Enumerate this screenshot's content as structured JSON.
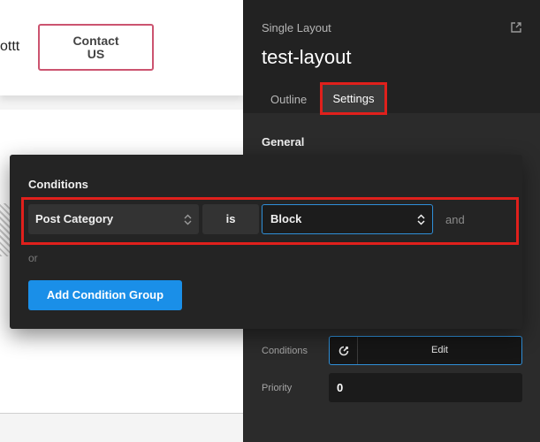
{
  "canvas": {
    "brand_fragment": "ottt",
    "contact_button_label": "Contact US"
  },
  "sidebar": {
    "subtitle": "Single Layout",
    "title": "test-layout",
    "tabs": [
      {
        "label": "Outline",
        "active": false
      },
      {
        "label": "Settings",
        "active": true
      }
    ],
    "section_general": "General",
    "conditions_label": "Conditions",
    "edit_label": "Edit",
    "priority_label": "Priority",
    "priority_value": "0"
  },
  "popup": {
    "title": "Conditions",
    "condition": {
      "category": "Post Category",
      "operator": "is",
      "value": "Block"
    },
    "and_label": "and",
    "or_label": "or",
    "add_group_label": "Add Condition Group"
  },
  "icons": {
    "export": "export-icon",
    "updown": "chevron-updown-icon",
    "condition": "conditions-icon"
  },
  "colors": {
    "accent_blue": "#1a8fe8",
    "highlight_red": "#e0201c",
    "contact_border": "#cc5470",
    "sidebar_bg": "#2b2b2b",
    "popup_bg": "#242424"
  }
}
